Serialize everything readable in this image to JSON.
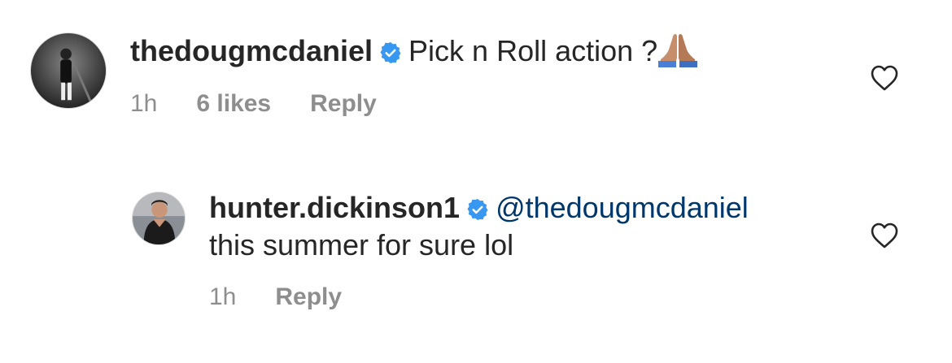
{
  "comments": [
    {
      "username": "thedougmcdaniel",
      "mention": "",
      "text": "Pick n Roll action ?",
      "emoji_icon": "folded-hands-icon",
      "time": "1h",
      "likes": "6 likes",
      "reply_label": "Reply"
    },
    {
      "username": "hunter.dickinson1",
      "mention": "@thedougmcdaniel",
      "text": "this summer for sure lol",
      "time": "1h",
      "reply_label": "Reply"
    }
  ],
  "icons": {
    "verified": "verified-badge-icon",
    "like": "heart-outline-icon"
  },
  "colors": {
    "verified_blue": "#3897f0",
    "mention_blue": "#00376b",
    "meta_gray": "#8e8e8e"
  }
}
